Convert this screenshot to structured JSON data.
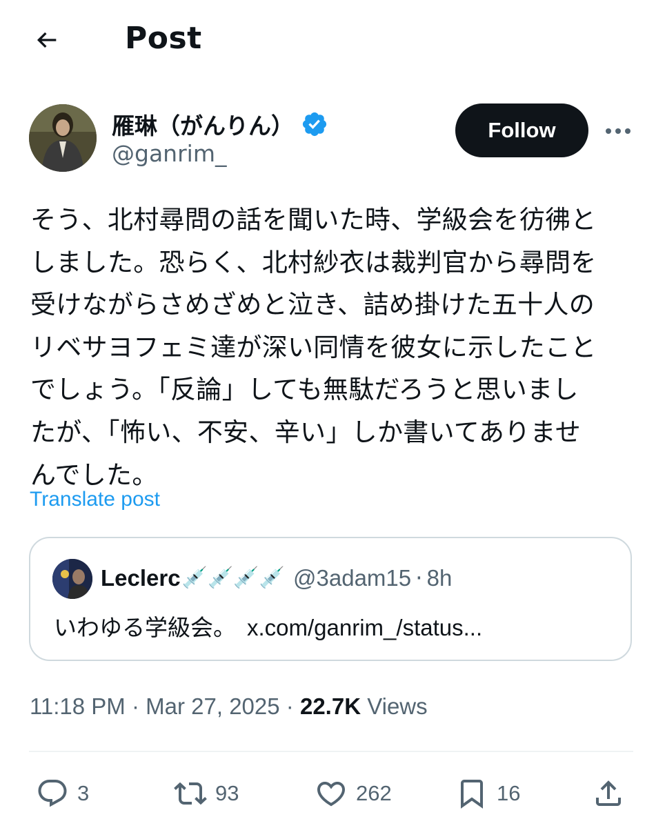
{
  "header": {
    "title": "Post",
    "back_icon": "arrow-left-icon"
  },
  "author": {
    "name": "雁琳（がんりん）",
    "handle": "@ganrim_",
    "verified": true,
    "verified_color": "#1d9bf0"
  },
  "follow_label": "Follow",
  "post": {
    "text": "そう、北村尋問の話を聞いた時、学級会を彷彿と\nしました。恐らく、北村紗衣は裁判官から尋問を\n受けながらさめざめと泣き、詰め掛けた五十人の\nリベサヨフェミ達が深い同情を彼女に示したこと\nでしょう。「反論」しても無駄だろうと思いまし\nたが、「怖い、不安、辛い」しか書いてありませ\nんでした。",
    "translate_label": "Translate post"
  },
  "quote": {
    "name": "Leclerc",
    "emojis": "💉💉💉💉",
    "handle": "@3adam15",
    "separator": "·",
    "time": "8h",
    "text": "いわゆる学級会。",
    "link": "x.com/ganrim_/status..."
  },
  "meta": {
    "time": "11:18 PM",
    "separator": "·",
    "date": "Mar 27, 2025",
    "views_count": "22.7K",
    "views_label": "Views"
  },
  "actions": {
    "replies": "3",
    "reposts": "93",
    "likes": "262",
    "bookmarks": "16"
  },
  "colors": {
    "text": "#0f1419",
    "secondary": "#536471",
    "accent": "#1d9bf0",
    "border": "#cfd9de"
  }
}
